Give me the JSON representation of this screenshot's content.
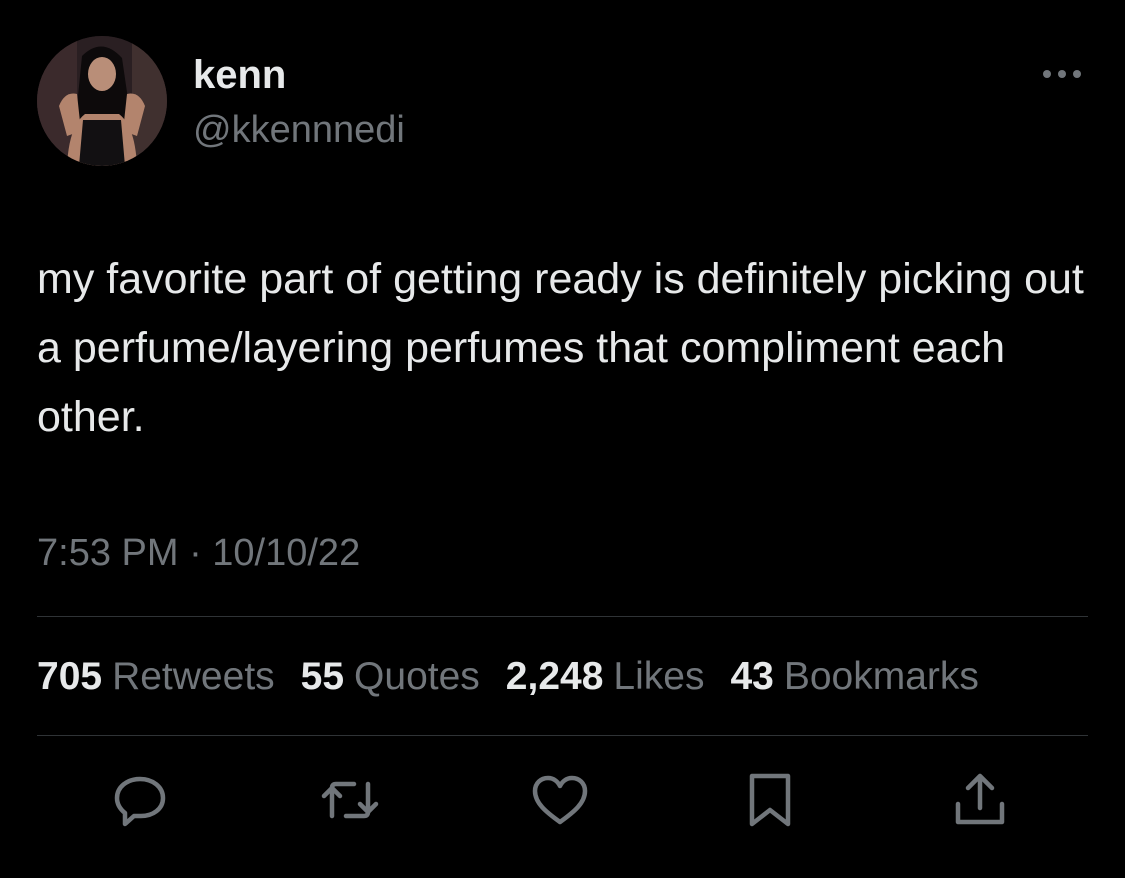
{
  "author": {
    "display_name": "kenn",
    "handle": "@kkennnedi",
    "avatar_icon": "profile-photo"
  },
  "more_icon": "more-options-icon",
  "tweet": {
    "text": "my favorite part of getting ready is definitely picking out a perfume/layering perfumes that compliment each other.",
    "timestamp": "7:53 PM · 10/10/22"
  },
  "stats": [
    {
      "count": "705",
      "label": "Retweets"
    },
    {
      "count": "55",
      "label": "Quotes"
    },
    {
      "count": "2,248",
      "label": "Likes"
    },
    {
      "count": "43",
      "label": "Bookmarks"
    }
  ],
  "actions": [
    "reply-icon",
    "retweet-icon",
    "like-icon",
    "bookmark-icon",
    "share-icon"
  ],
  "colors": {
    "background": "#000000",
    "primary_text": "#e7e9ea",
    "secondary_text": "#71767b",
    "divider": "#2f3336"
  }
}
